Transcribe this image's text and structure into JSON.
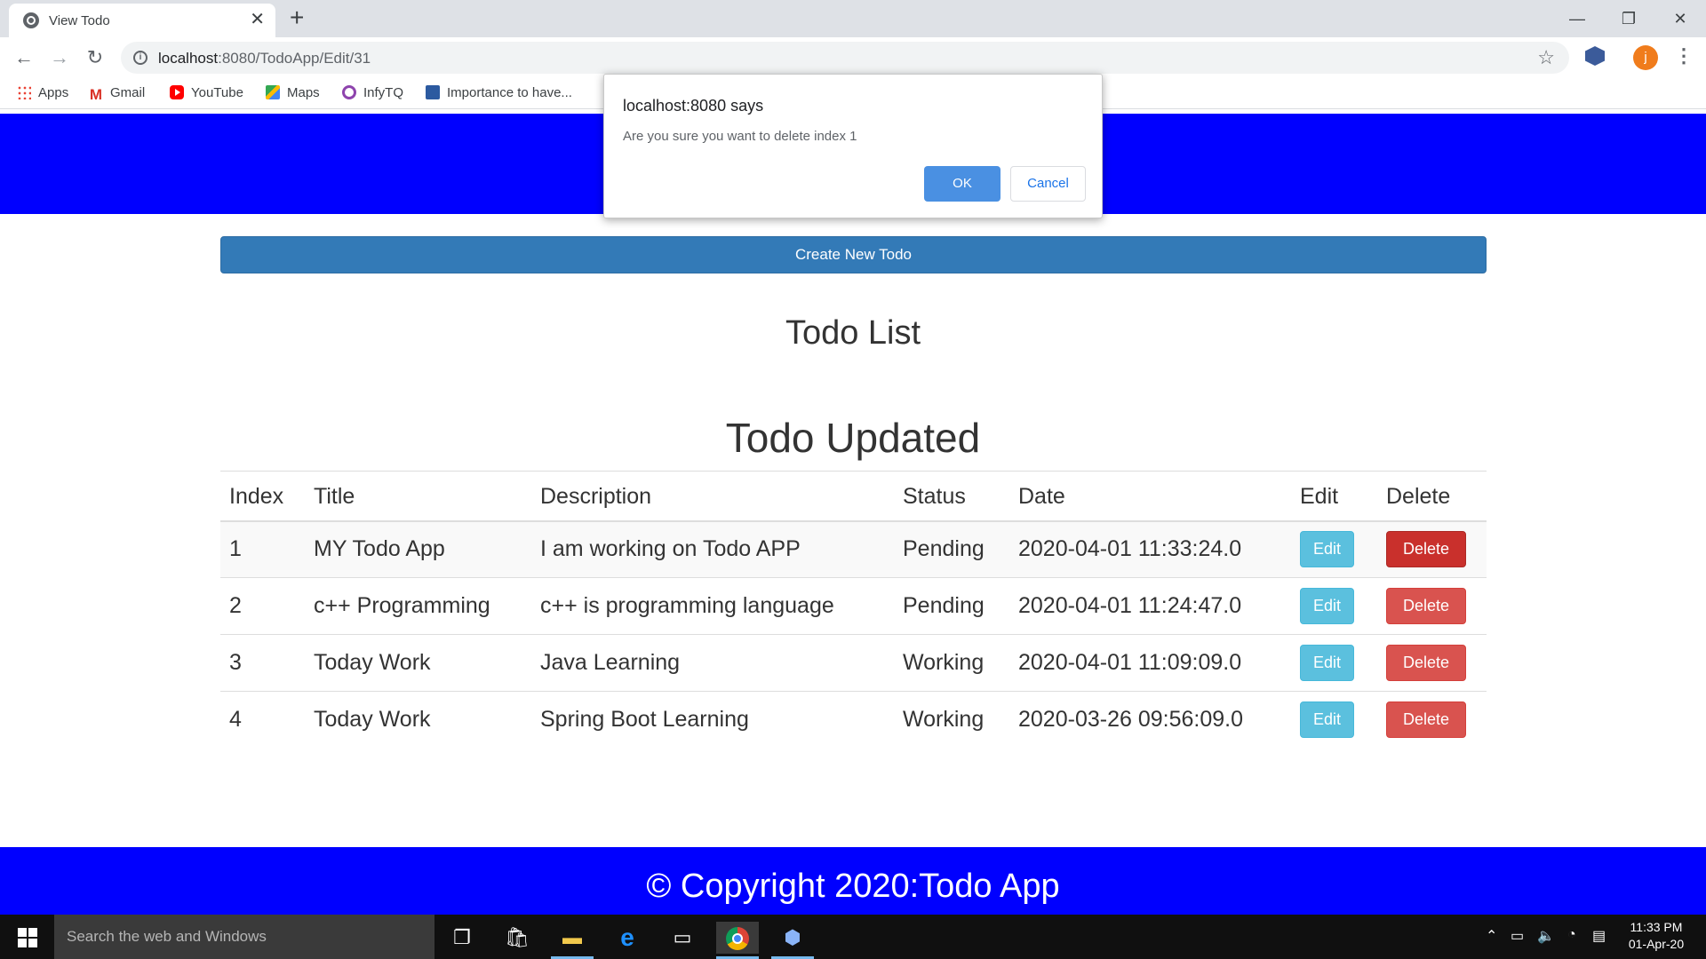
{
  "browser": {
    "tab_title": "View Todo",
    "tab_close": "✕",
    "new_tab": "+",
    "url_host": "localhost",
    "url_path": ":8080/TodoApp/Edit/31",
    "window_minimize": "—",
    "window_restore": "❐",
    "window_close": "✕",
    "profile_initial": "j",
    "bookmarks": [
      {
        "label": "Apps",
        "icon": "apps-grid-icon"
      },
      {
        "label": "Gmail",
        "icon": "gmail-icon"
      },
      {
        "label": "YouTube",
        "icon": "youtube-icon"
      },
      {
        "label": "Maps",
        "icon": "maps-icon"
      },
      {
        "label": "InfyTQ",
        "icon": "infytq-icon"
      },
      {
        "label": "Importance to have...",
        "icon": "bookmark-site-icon"
      }
    ]
  },
  "page": {
    "create_button": "Create New Todo",
    "list_title": "Todo List",
    "status_message": "Todo Updated",
    "table": {
      "headers": [
        "Index",
        "Title",
        "Description",
        "Status",
        "Date",
        "Edit",
        "Delete"
      ],
      "rows": [
        {
          "index": "1",
          "title": "MY Todo App",
          "description": "I am working on Todo APP",
          "status": "Pending",
          "date": "2020-04-01 11:33:24.0",
          "edit": "Edit",
          "delete": "Delete"
        },
        {
          "index": "2",
          "title": "c++ Programming",
          "description": "c++ is programming language",
          "status": "Pending",
          "date": "2020-04-01 11:24:47.0",
          "edit": "Edit",
          "delete": "Delete"
        },
        {
          "index": "3",
          "title": "Today Work",
          "description": "Java Learning",
          "status": "Working",
          "date": "2020-04-01 11:09:09.0",
          "edit": "Edit",
          "delete": "Delete"
        },
        {
          "index": "4",
          "title": "Today Work",
          "description": "Spring Boot Learning",
          "status": "Working",
          "date": "2020-03-26 09:56:09.0",
          "edit": "Edit",
          "delete": "Delete"
        }
      ]
    },
    "footer": "© Copyright 2020:Todo App"
  },
  "dialog": {
    "title": "localhost:8080 says",
    "message": "Are you sure you want to delete index 1",
    "ok": "OK",
    "cancel": "Cancel"
  },
  "taskbar": {
    "search_placeholder": "Search the web and Windows",
    "time": "11:33 PM",
    "date": "01-Apr-20"
  },
  "colors": {
    "header_band": "#0000ff",
    "primary_button": "#337ab7",
    "edit_button": "#5bc0de",
    "delete_button": "#d9534f"
  }
}
